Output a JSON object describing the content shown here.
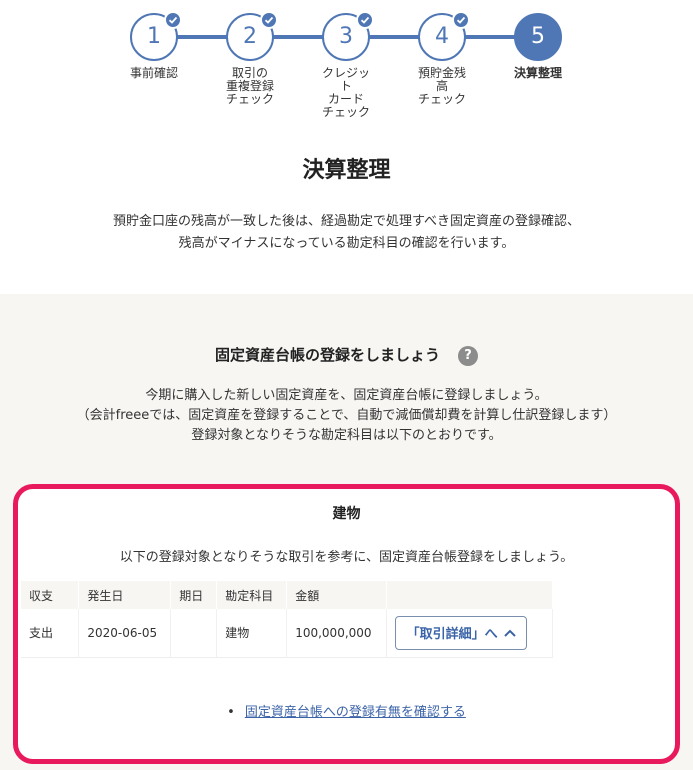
{
  "stepper": {
    "steps": [
      {
        "number": "1",
        "label": "事前確認",
        "done": true
      },
      {
        "number": "2",
        "label": "取引の\n重複登録\nチェック",
        "done": true
      },
      {
        "number": "3",
        "label": "クレジッ\nト\nカード\nチェック",
        "done": true
      },
      {
        "number": "4",
        "label": "預貯金残\n高\nチェック",
        "done": true
      },
      {
        "number": "5",
        "label": "決算整理",
        "done": false,
        "active": true
      }
    ]
  },
  "header": {
    "title": "決算整理",
    "intro_line1": "預貯金口座の残高が一致した後は、経過勘定で処理すべき固定資産の登録確認、",
    "intro_line2": "残高がマイナスになっている勘定科目の確認を行います。"
  },
  "section": {
    "title": "固定資産台帳の登録をしましょう",
    "help_icon": "?",
    "desc_line1": "今期に購入した新しい固定資産を、固定資産台帳に登録しましょう。",
    "desc_line2": "（会計freeeでは、固定資産を登録することで、自動で減価償却費を計算し仕訳登録します）",
    "desc_line3": "登録対象となりそうな勘定科目は以下のとおりです。"
  },
  "card": {
    "title": "建物",
    "desc": "以下の登録対象となりそうな取引を参考に、固定資産台帳登録をしましょう。",
    "table": {
      "headers": [
        "収支",
        "発生日",
        "期日",
        "勘定科目",
        "金額",
        ""
      ],
      "rows": [
        {
          "type": "支出",
          "date": "2020-06-05",
          "due": "",
          "account": "建物",
          "amount": "100,000,000",
          "button": "「取引詳細」へ"
        }
      ]
    },
    "link_bullet": "•",
    "link": "固定資産台帳への登録有無を確認する"
  },
  "colors": {
    "accent": "#4f77b5",
    "highlight_border": "#e8195c",
    "section_bg": "#f7f6f3",
    "link": "#3b63a8"
  }
}
